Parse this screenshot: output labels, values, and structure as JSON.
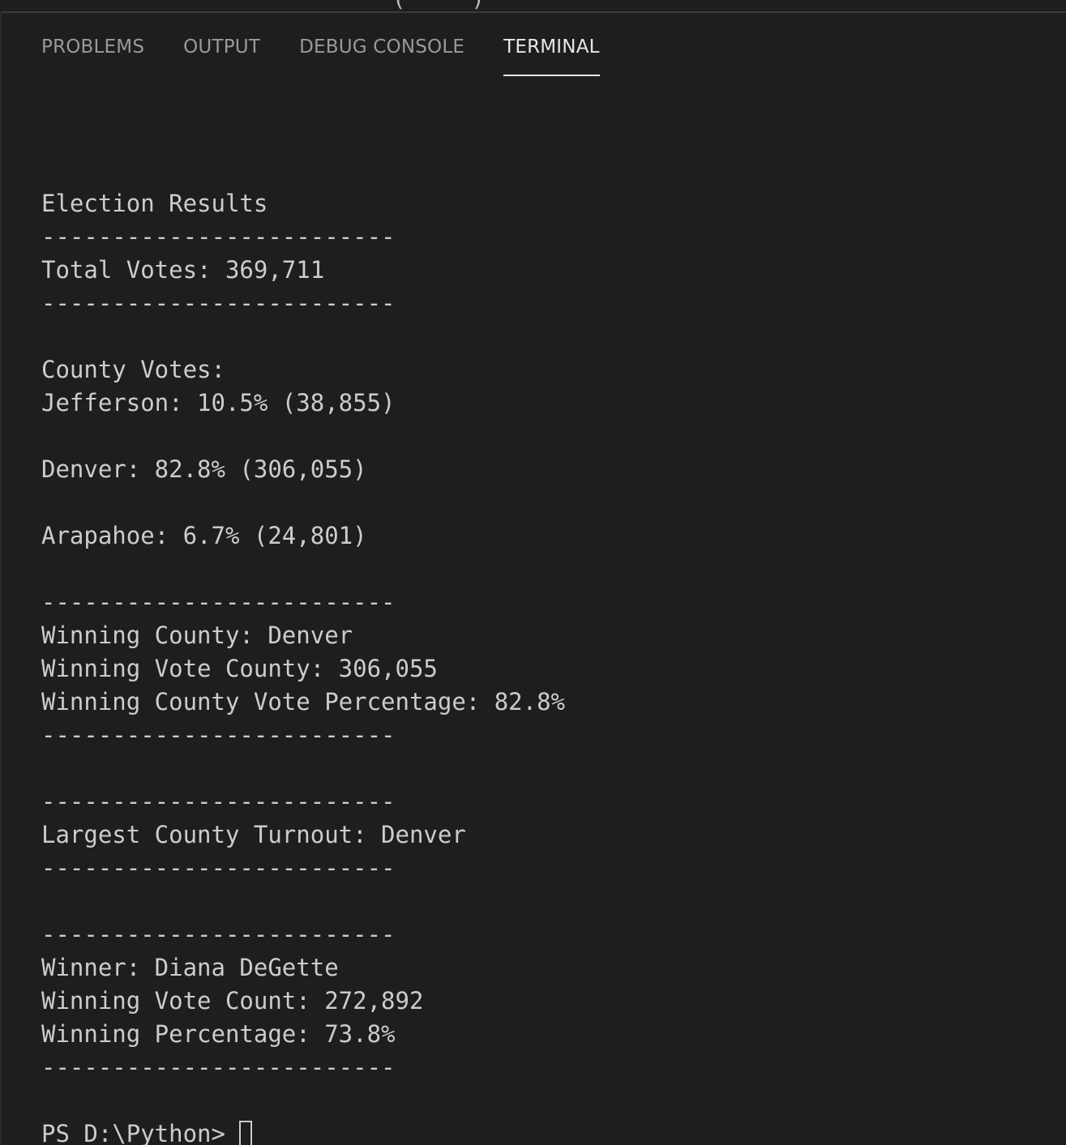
{
  "window": {
    "title_fragment": "(     )"
  },
  "tabs": [
    {
      "label": "PROBLEMS",
      "active": false
    },
    {
      "label": "OUTPUT",
      "active": false
    },
    {
      "label": "DEBUG CONSOLE",
      "active": false
    },
    {
      "label": "TERMINAL",
      "active": true
    }
  ],
  "terminal": {
    "lines": [
      "",
      "Election Results",
      "-------------------------",
      "Total Votes: 369,711",
      "-------------------------",
      "",
      "County Votes:",
      "Jefferson: 10.5% (38,855)",
      "",
      "Denver: 82.8% (306,055)",
      "",
      "Arapahoe: 6.7% (24,801)",
      "",
      "-------------------------",
      "Winning County: Denver",
      "Winning Vote County: 306,055",
      "Winning County Vote Percentage: 82.8%",
      "-------------------------",
      "",
      "-------------------------",
      "Largest County Turnout: Denver",
      "-------------------------",
      "",
      "-------------------------",
      "Winner: Diana DeGette",
      "Winning Vote Count: 272,892",
      "Winning Percentage: 73.8%",
      "-------------------------",
      ""
    ],
    "prompt": "PS D:\\Python>"
  },
  "colors": {
    "background": "#1e1e1e",
    "text": "#cccccc",
    "tab_inactive": "#9a9a9a",
    "tab_active": "#e7e7e7"
  }
}
